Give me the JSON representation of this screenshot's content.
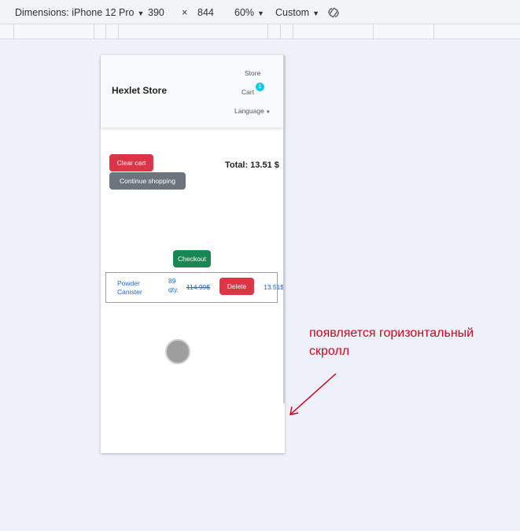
{
  "devtools": {
    "dimensions_label": "Dimensions: iPhone 12 Pro",
    "width": "390",
    "times": "×",
    "height": "844",
    "zoom": "60%",
    "throttle": "Custom",
    "rotate_icon": "rotate-icon"
  },
  "app": {
    "brand": "Hexlet Store",
    "nav": {
      "store": "Store",
      "cart": "Cart",
      "cart_badge": "1",
      "language": "Language"
    },
    "buttons": {
      "clear_cart": "Clear cart",
      "continue_shopping": "Continue shopping",
      "checkout": "Checkout",
      "delete": "Delete"
    },
    "total": "Total: 13.51 $",
    "cart_item": {
      "name": "Powder Canister",
      "qty": "89 qty.",
      "old_price": "114.99$",
      "price": "13.51$"
    }
  },
  "annotation": {
    "text": "появляется горизонтальный скролл",
    "color": "#d0021b"
  },
  "colors": {
    "danger": "#dc3545",
    "secondary": "#6c757d",
    "success": "#198754",
    "info": "#0dcaf0",
    "link": "#0d6efd"
  }
}
